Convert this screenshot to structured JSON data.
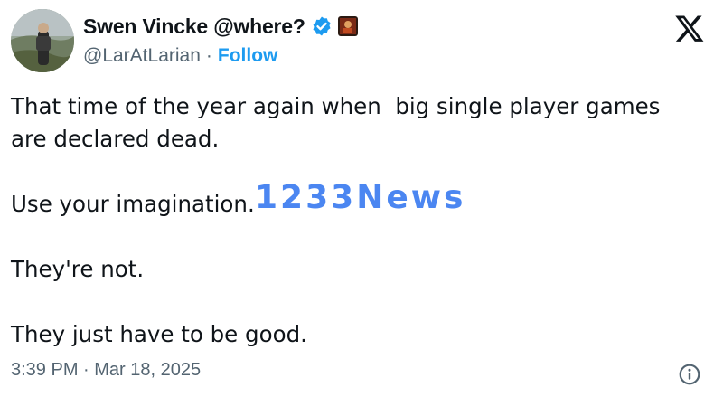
{
  "author": {
    "display_name": "Swen Vincke @where?",
    "handle": "@LarAtLarian",
    "separator": "·",
    "follow_label": "Follow",
    "verified": true
  },
  "icons": {
    "verified": "verified-badge-icon",
    "affiliate": "affiliate-badge-icon",
    "platform": "x-logo-icon",
    "info": "info-icon"
  },
  "tweet": {
    "lines": [
      "That time of the year again when  big single player games",
      "are declared dead.",
      "",
      "Use your imagination.",
      "",
      "They're not.",
      "",
      "They just have to be good."
    ],
    "timestamp": "3:39 PM · Mar 18, 2025"
  },
  "watermark": {
    "text": "1233News"
  },
  "colors": {
    "text": "#0f1419",
    "secondary": "#536471",
    "accent": "#1d9bf0",
    "watermark": "#3c7cf0"
  }
}
